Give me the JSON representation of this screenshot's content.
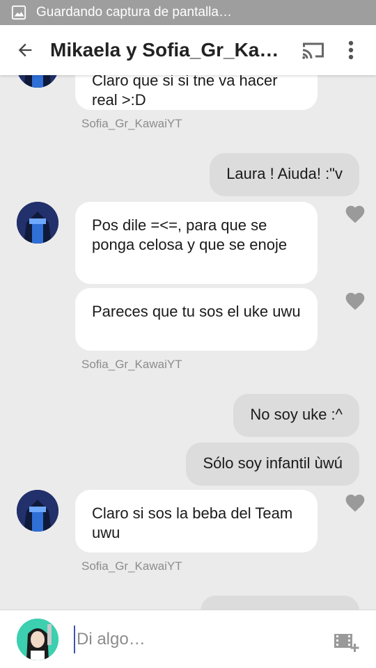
{
  "status_bar": {
    "notification_text": "Guardando captura de pantalla…",
    "icon": "image-icon"
  },
  "app_bar": {
    "title": "Mikaela y Sofia_Gr_KawaiYT",
    "back_icon": "arrow-left-icon",
    "cast_icon": "cast-icon",
    "more_icon": "more-vert-icon"
  },
  "messages": [
    {
      "side": "in",
      "text": "Claro que si si tne va hacer real >:D",
      "partial_top": true
    },
    {
      "side": "sender",
      "text": "Sofia_Gr_KawaiYT"
    },
    {
      "side": "out",
      "text": "Laura ! Aiuda!  :\"v"
    },
    {
      "side": "in",
      "text": "Pos dile =<=,  para que se ponga celosa y que se enoje"
    },
    {
      "side": "in",
      "text": "Pareces que tu sos el uke uwu"
    },
    {
      "side": "sender",
      "text": "Sofia_Gr_KawaiYT"
    },
    {
      "side": "out",
      "text": "No soy uke :^"
    },
    {
      "side": "out",
      "text": "Sólo soy infantil ùwú"
    },
    {
      "side": "in",
      "text": "Claro si sos la beba del Team uwu"
    },
    {
      "side": "sender",
      "text": "Sofia_Gr_KawaiYT"
    }
  ],
  "input": {
    "placeholder": "Di algo…",
    "media_icon": "media-add-icon"
  },
  "colors": {
    "background": "#ebebeb",
    "incoming_bubble": "#ffffff",
    "outgoing_bubble": "#dcdcdc",
    "heart": "#9a9a9a",
    "status_bar": "#9e9e9e",
    "cursor_accent": "#3f51b5"
  }
}
